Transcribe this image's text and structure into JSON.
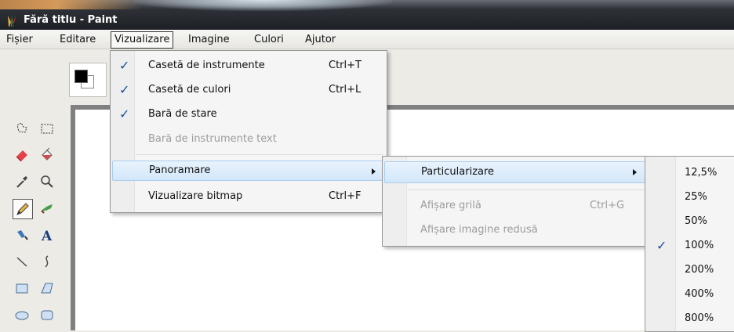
{
  "window": {
    "title": "Fără titlu - Paint"
  },
  "menubar": {
    "items": [
      {
        "label": "Fișier"
      },
      {
        "label": "Editare"
      },
      {
        "label": "Vizualizare"
      },
      {
        "label": "Imagine"
      },
      {
        "label": "Culori"
      },
      {
        "label": "Ajutor"
      }
    ]
  },
  "view_menu": {
    "items": [
      {
        "label": "Casetă de instrumente",
        "shortcut": "Ctrl+T",
        "checked": true
      },
      {
        "label": "Casetă de culori",
        "shortcut": "Ctrl+L",
        "checked": true
      },
      {
        "label": "Bară de stare",
        "checked": true
      },
      {
        "label": "Bară de instrumente text",
        "disabled": true
      },
      {
        "label": "Panoramare",
        "submenu": true
      },
      {
        "label": "Vizualizare bitmap",
        "shortcut": "Ctrl+F"
      }
    ]
  },
  "zoom_menu": {
    "items": [
      {
        "label": "Particularizare",
        "submenu": true
      },
      {
        "label": "Afișare grilă",
        "shortcut": "Ctrl+G",
        "disabled": true
      },
      {
        "label": "Afișare imagine redusă",
        "disabled": true
      }
    ]
  },
  "zoom_levels": {
    "items": [
      {
        "label": "12,5%"
      },
      {
        "label": "25%"
      },
      {
        "label": "50%"
      },
      {
        "label": "100%",
        "checked": true
      },
      {
        "label": "200%"
      },
      {
        "label": "400%"
      },
      {
        "label": "800%"
      }
    ]
  },
  "colors": {
    "accent": "#1f4e9c",
    "foreground": "#000000",
    "background": "#ffffff"
  },
  "check_glyph": "✓"
}
